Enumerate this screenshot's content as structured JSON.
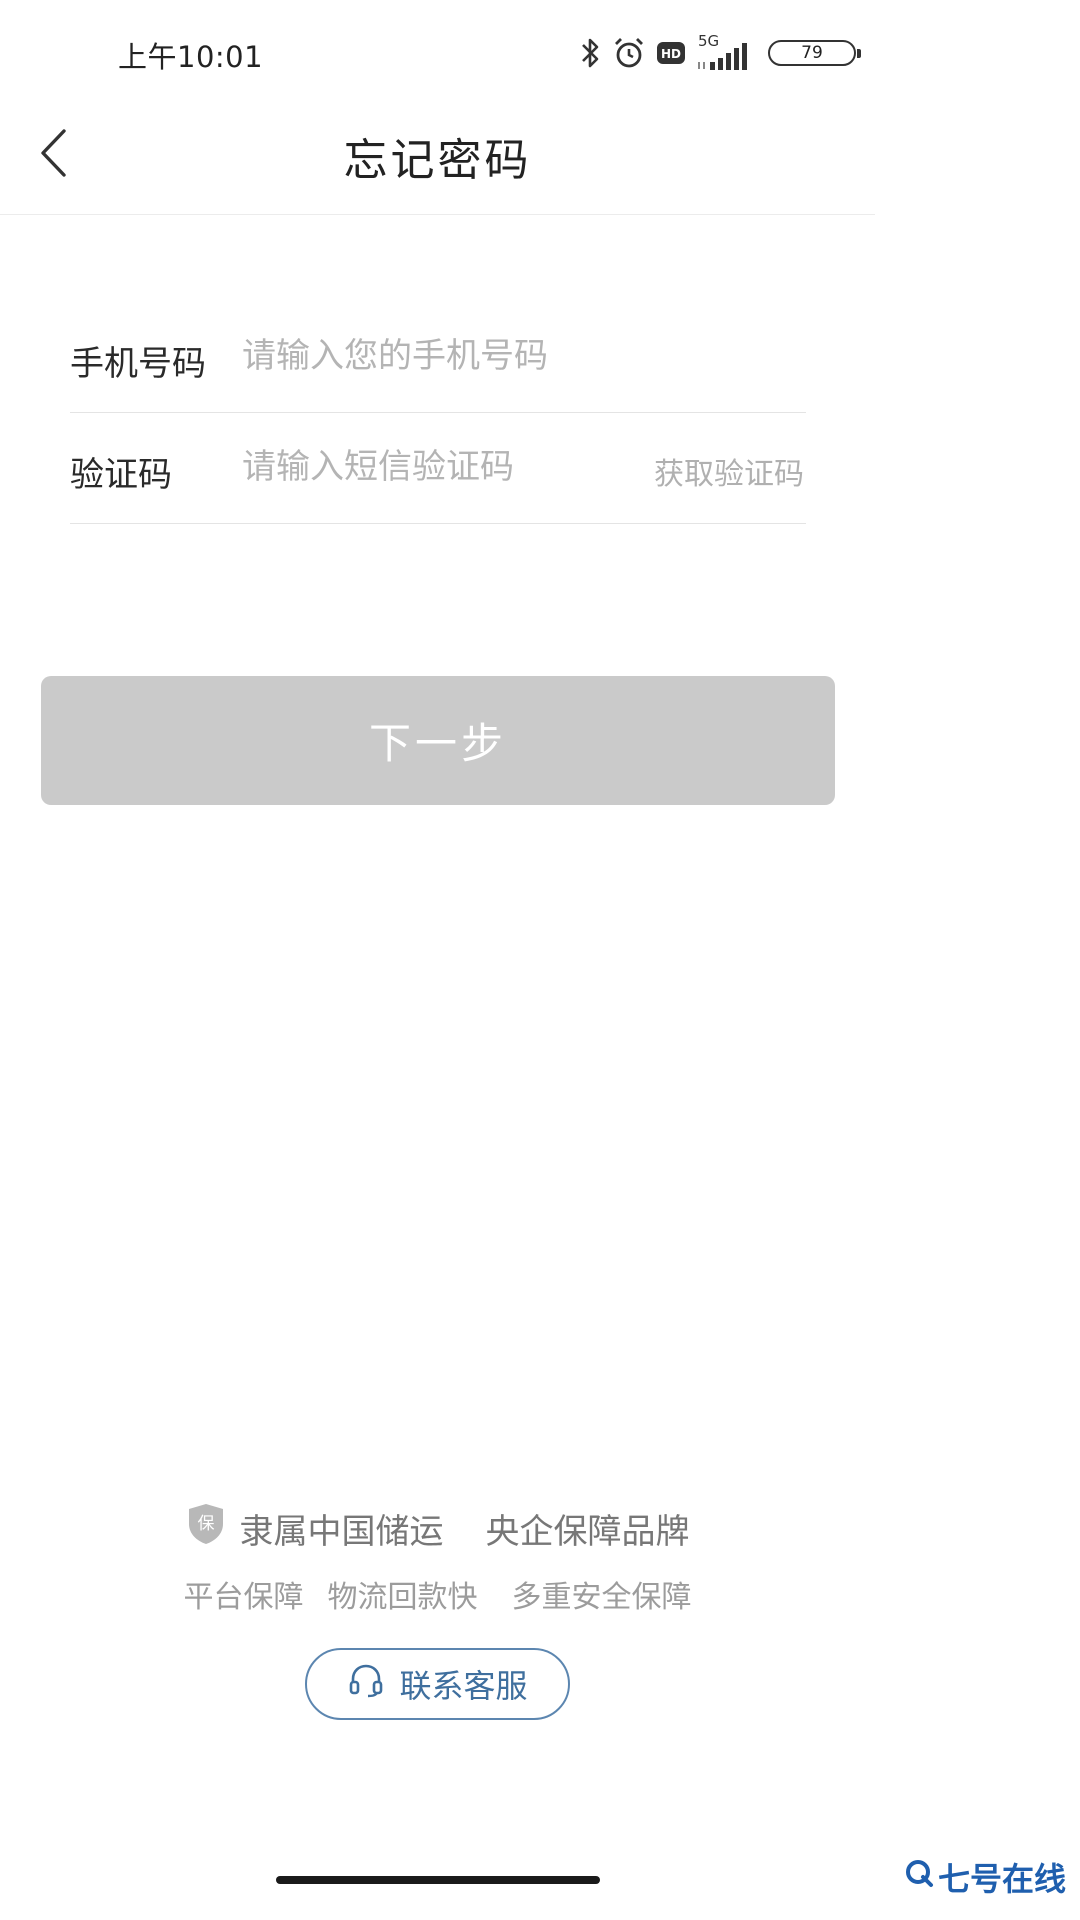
{
  "status_bar": {
    "time": "上午10:01",
    "network": "5G",
    "battery": "79",
    "icons": [
      "bluetooth-icon",
      "alarm-icon",
      "hd-icon",
      "signal-icon",
      "battery-icon"
    ]
  },
  "header": {
    "title": "忘记密码",
    "back_icon": "chevron-left-icon"
  },
  "form": {
    "phone": {
      "label": "手机号码",
      "placeholder": "请输入您的手机号码",
      "value": ""
    },
    "code": {
      "label": "验证码",
      "placeholder": "请输入短信验证码",
      "value": "",
      "action_label": "获取验证码"
    }
  },
  "next_button": {
    "label": "下一步",
    "background": "#cacaca"
  },
  "footer": {
    "badge_text": "保",
    "brand_left": "隶属中国储运",
    "brand_right": "央企保障品牌",
    "features": [
      "平台保障",
      "物流回款快",
      "多重安全保障"
    ],
    "contact_label": "联系客服",
    "contact_icon": "headset-icon",
    "accent": "#3f6f9e"
  },
  "watermark": {
    "text": "七号在线"
  }
}
